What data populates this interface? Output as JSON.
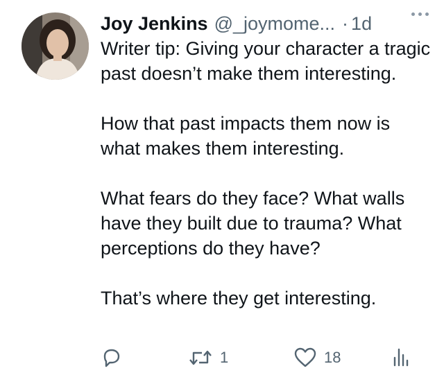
{
  "author": {
    "name": "Joy Jenkins",
    "handle": "@_joymome...",
    "separator": "·",
    "time": "1d"
  },
  "tweet": {
    "paragraphs": [
      "Writer tip: Giving your character a tragic past doesn’t make them interesting.",
      "How that past impacts them now is what makes them interesting.",
      "What fears do they face? What walls have they built due to trauma? What perceptions do they have?",
      "That’s where they get interesting."
    ]
  },
  "actions": {
    "reply": {
      "icon": "reply-icon",
      "count": ""
    },
    "retweet": {
      "icon": "retweet-icon",
      "count": "1"
    },
    "like": {
      "icon": "heart-icon",
      "count": "18"
    },
    "analytics": {
      "icon": "analytics-icon"
    }
  },
  "colors": {
    "text": "#0f1419",
    "secondary": "#536471"
  }
}
